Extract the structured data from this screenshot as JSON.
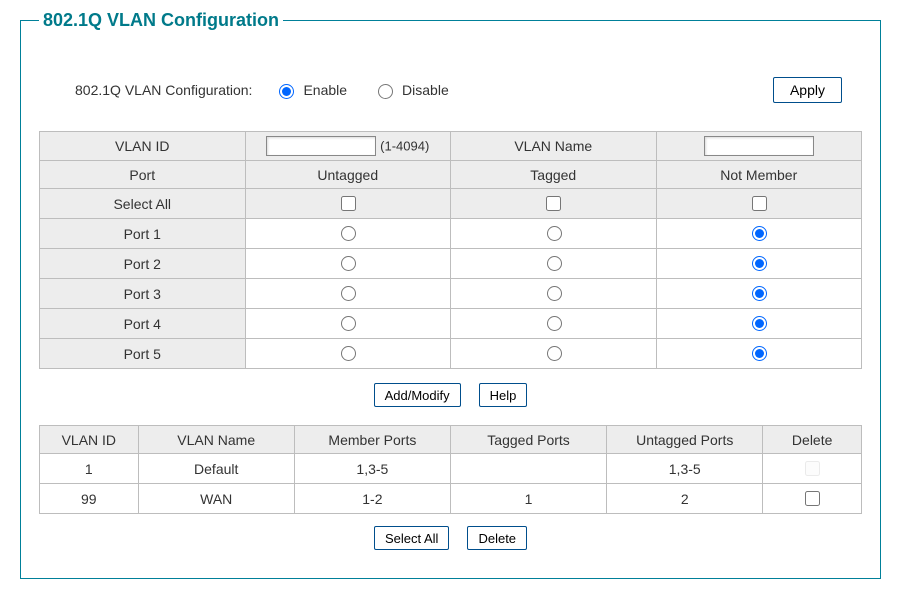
{
  "title": "802.1Q VLAN Configuration",
  "enable_row": {
    "label": "802.1Q VLAN Configuration:",
    "enable_label": "Enable",
    "disable_label": "Disable",
    "selected": "enable",
    "apply_label": "Apply"
  },
  "config": {
    "headers": {
      "vlan_id": "VLAN ID",
      "vlan_id_range": "(1-4094)",
      "vlan_name": "VLAN Name",
      "port": "Port",
      "untagged": "Untagged",
      "tagged": "Tagged",
      "not_member": "Not Member",
      "select_all": "Select All"
    },
    "vlan_id_value": "",
    "vlan_name_value": "",
    "ports": [
      {
        "name": "Port 1",
        "selected": "not_member"
      },
      {
        "name": "Port 2",
        "selected": "not_member"
      },
      {
        "name": "Port 3",
        "selected": "not_member"
      },
      {
        "name": "Port 4",
        "selected": "not_member"
      },
      {
        "name": "Port 5",
        "selected": "not_member"
      }
    ],
    "buttons": {
      "add_modify": "Add/Modify",
      "help": "Help"
    }
  },
  "summary": {
    "headers": {
      "vlan_id": "VLAN ID",
      "vlan_name": "VLAN Name",
      "member_ports": "Member Ports",
      "tagged_ports": "Tagged Ports",
      "untagged_ports": "Untagged Ports",
      "delete": "Delete"
    },
    "rows": [
      {
        "vlan_id": "1",
        "vlan_name": "Default",
        "member_ports": "1,3-5",
        "tagged_ports": "",
        "untagged_ports": "1,3-5",
        "deletable": false
      },
      {
        "vlan_id": "99",
        "vlan_name": "WAN",
        "member_ports": "1-2",
        "tagged_ports": "1",
        "untagged_ports": "2",
        "deletable": true
      }
    ],
    "buttons": {
      "select_all": "Select All",
      "delete": "Delete"
    }
  }
}
